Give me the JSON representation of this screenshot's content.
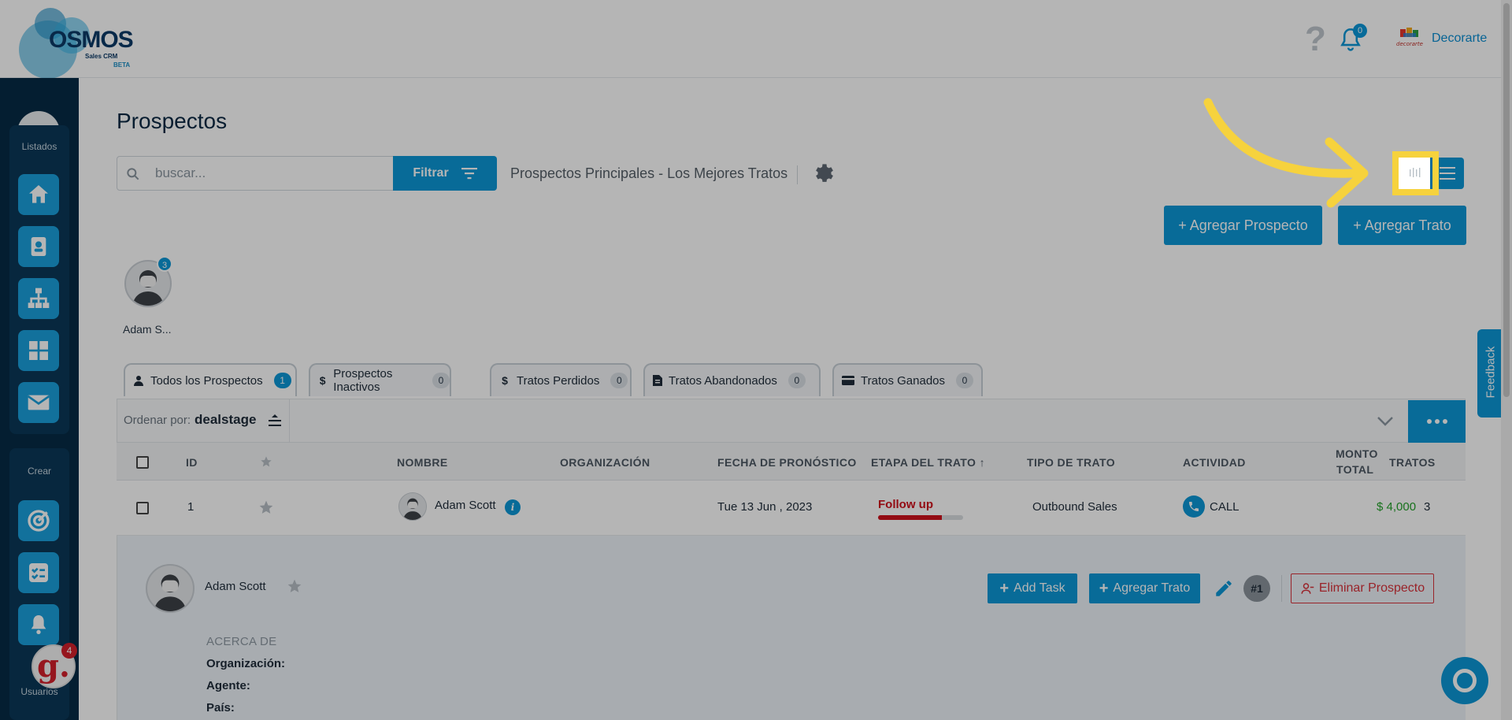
{
  "header": {
    "logo_word": "OSMOS",
    "logo_sub": "Sales CRM",
    "logo_beta": "BETA",
    "notifications_count": "0",
    "company_name": "Decorarte",
    "company_logo_text": "decorarte"
  },
  "sidebar": {
    "label_listados": "Listados",
    "label_crear": "Crear",
    "label_usuarios": "Usuarios",
    "widget_letter": "g.",
    "widget_badge": "4"
  },
  "page": {
    "title": "Prospectos",
    "search_placeholder": "buscar...",
    "filter_label": "Filtrar",
    "view_title": "Prospectos Principales - Los Mejores Tratos",
    "add_prospect_label": "+ Agregar Prospecto",
    "add_deal_label": "+ Agregar Trato"
  },
  "agent": {
    "name": "Adam S...",
    "count": "3"
  },
  "tabs": [
    {
      "label": "Todos los Prospectos",
      "count": "1",
      "icon": "user-icon"
    },
    {
      "label": "Prospectos Inactivos",
      "count": "0",
      "icon": "dollar-icon"
    },
    {
      "label": "Tratos Perdidos",
      "count": "0",
      "icon": "dollar-icon"
    },
    {
      "label": "Tratos Abandonados",
      "count": "0",
      "icon": "document-icon"
    },
    {
      "label": "Tratos Ganados",
      "count": "0",
      "icon": "card-icon"
    }
  ],
  "sort": {
    "label": "Ordenar por:",
    "value": "dealstage"
  },
  "table": {
    "columns": [
      "ID",
      "NOMBRE",
      "ORGANIZACIÓN",
      "FECHA DE PRONÓSTICO",
      "ETAPA DEL TRATO ↑",
      "TIPO DE TRATO",
      "ACTIVIDAD",
      "MONTO",
      "TOTAL",
      "TRATOS"
    ],
    "rows": [
      {
        "id": "1",
        "name": "Adam Scott",
        "organization": "",
        "forecast_date": "Tue 13 Jun , 2023",
        "stage": "Follow up",
        "stage_progress": 0.75,
        "deal_type": "Outbound Sales",
        "activity": "CALL",
        "amount": "$ 4,000",
        "deals": "3"
      }
    ]
  },
  "detail": {
    "name": "Adam Scott",
    "add_task_label": "Add Task",
    "add_deal_label": "Agregar Trato",
    "hash_label": "#1",
    "delete_label": "Eliminar Prospecto",
    "about_heading": "ACERCA DE",
    "org_label": "Organización:",
    "agent_label": "Agente:",
    "country_label": "País:"
  },
  "feedback_label": "Feedback",
  "colors": {
    "primary": "#0c97d6",
    "sidebar": "#062b45",
    "stage_red": "#d0101b",
    "amount_green": "#23a12a",
    "highlight": "#f6d23d"
  }
}
